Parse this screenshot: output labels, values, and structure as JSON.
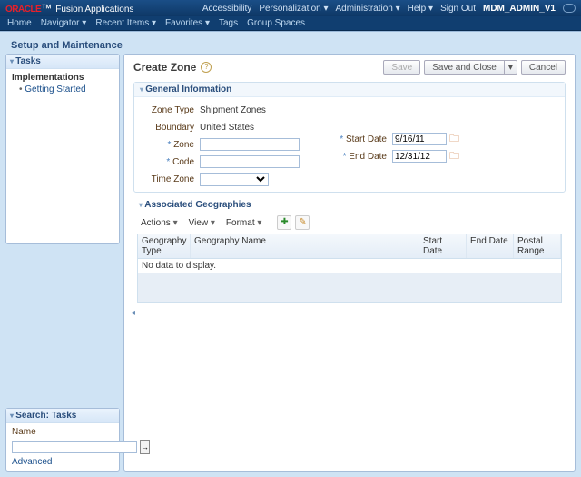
{
  "brand": {
    "o": "ORACLE",
    "f": "Fusion Applications"
  },
  "topLinks": {
    "access": "Accessibility",
    "pers": "Personalization",
    "admin": "Administration",
    "help": "Help",
    "signout": "Sign Out",
    "user": "MDM_ADMIN_V1"
  },
  "subnav": {
    "home": "Home",
    "nav": "Navigator",
    "recent": "Recent Items",
    "fav": "Favorites",
    "tags": "Tags",
    "spaces": "Group Spaces"
  },
  "pageTitle": "Setup and Maintenance",
  "tasks": {
    "panelTitle": "Tasks",
    "heading": "Implementations",
    "item1": "Getting Started"
  },
  "search": {
    "panelTitle": "Search: Tasks",
    "nameLabel": "Name",
    "nameValue": "",
    "advanced": "Advanced"
  },
  "main": {
    "title": "Create Zone",
    "buttons": {
      "save": "Save",
      "saveClose": "Save and Close",
      "cancel": "Cancel"
    }
  },
  "general": {
    "title": "General Information",
    "zoneTypeLabel": "Zone Type",
    "zoneTypeVal": "Shipment Zones",
    "boundaryLabel": "Boundary",
    "boundaryVal": "United States",
    "zoneLabel": "Zone",
    "zoneVal": "",
    "codeLabel": "Code",
    "codeVal": "",
    "tzLabel": "Time Zone",
    "tzVal": "",
    "startLabel": "Start Date",
    "startVal": "9/16/11",
    "endLabel": "End Date",
    "endVal": "12/31/12"
  },
  "geo": {
    "title": "Associated Geographies",
    "actions": "Actions",
    "view": "View",
    "format": "Format",
    "cols": {
      "type": "Geography Type",
      "name": "Geography Name",
      "sd": "Start Date",
      "ed": "End Date",
      "pr": "Postal Range"
    },
    "empty": "No data to display."
  }
}
